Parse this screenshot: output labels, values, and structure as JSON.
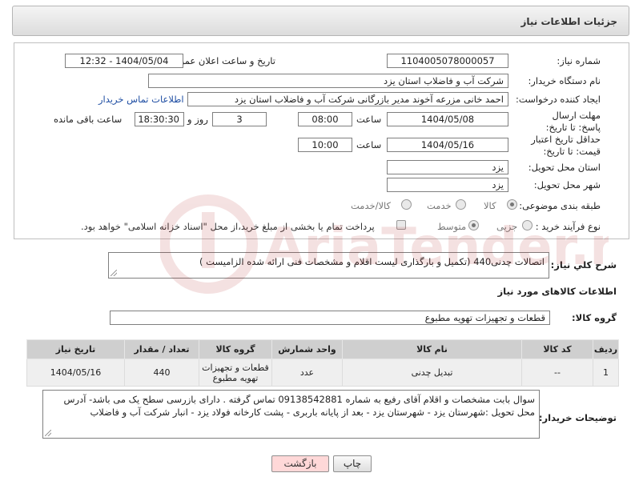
{
  "header": {
    "title": "جزئیات اطلاعات نیاز"
  },
  "form": {
    "need_number": {
      "label": "شماره نیاز:",
      "value": "1104005078000057"
    },
    "announce": {
      "label": "تاریخ و ساعت اعلان عمومی:",
      "value": "1404/05/04 - 12:32"
    },
    "buyer_org": {
      "label": "نام دستگاه خریدار:",
      "value": "شرکت آب و فاضلاب استان یزد"
    },
    "requester": {
      "label": "ایجاد کننده درخواست:",
      "value": "احمد خانی مزرعه آخوند مدیر بازرگانی شرکت آب و فاضلاب استان یزد",
      "contact_link": "اطلاعات تماس خریدار"
    },
    "deadline": {
      "label": "مهلت ارسال پاسخ: تا تاریخ:",
      "date": "1404/05/08",
      "time_label": "ساعت",
      "time": "08:00",
      "days": "3",
      "days_label": "روز و",
      "remaining": "18:30:30",
      "remaining_label": "ساعت باقی مانده"
    },
    "price_validity": {
      "label": "حداقل تاریخ اعتبار قیمت: تا تاریخ:",
      "date": "1404/05/16",
      "time_label": "ساعت",
      "time": "10:00"
    },
    "province": {
      "label": "استان محل تحویل:",
      "value": "یزد"
    },
    "city": {
      "label": "شهر محل تحویل:",
      "value": "یزد"
    },
    "category": {
      "label": "طبقه بندی موضوعی:",
      "options": [
        "کالا",
        "خدمت",
        "کالا/خدمت"
      ],
      "selected": "کالا"
    },
    "process": {
      "label": "نوع فرآیند خرید :",
      "options": [
        "جزیی",
        "متوسط"
      ],
      "selected": "متوسط",
      "payment_note": "پرداخت تمام یا بخشی از مبلغ خرید،از محل \"اسناد خزانه اسلامی\" خواهد بود."
    }
  },
  "description": {
    "label": "شرح کلي نياز:",
    "value": "اتصالات چدنی440  (تکمیل و بارگذاری لیست اقلام و مشخصات فنی ارائه شده الزامیست )"
  },
  "goods_info": {
    "title": "اطلاعات کالاهای مورد نیاز",
    "group_label": "گروه کالا:",
    "group_value": "قطعات و تجهیزات تهویه مطبوع"
  },
  "table": {
    "headers": [
      "ردیف",
      "کد کالا",
      "نام کالا",
      "واحد شمارش",
      "گروه کالا",
      "تعداد / مقدار",
      "تاریخ نیاز"
    ],
    "rows": [
      [
        "1",
        "--",
        "تبدیل چدنی",
        "عدد",
        "قطعات و تجهیزات تهویه مطبوع",
        "440",
        "1404/05/16"
      ]
    ]
  },
  "buyer_notes": {
    "label": "توضیحات خریدار:",
    "value": "سوال بابت مشخصات و اقلام آقای رفیع به شماره 09138542881 تماس گرفته . دارای بازرسی سطح یک می باشد- آدرس محل تحویل :شهرستان یزد - شهرستان یزد - بعد از پایانه باربری - پشت کارخانه فولاد یزد - انبار شرکت آب و فاضلاب"
  },
  "buttons": {
    "print": "چاپ",
    "back": "بازگشت"
  },
  "watermark": {
    "text": "AriaTender.neT"
  },
  "colors": {
    "link": "#1f4ea3",
    "back_button": "#ffd8d8",
    "table_header": "#cfcfcf"
  }
}
